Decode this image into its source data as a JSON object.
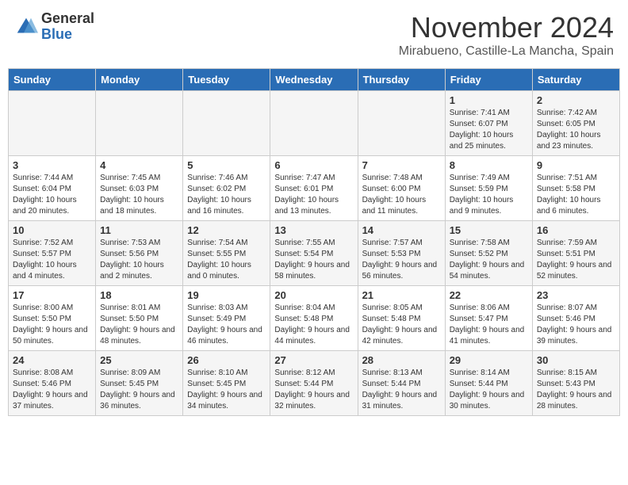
{
  "header": {
    "logo_general": "General",
    "logo_blue": "Blue",
    "month_title": "November 2024",
    "location": "Mirabueno, Castille-La Mancha, Spain"
  },
  "days_of_week": [
    "Sunday",
    "Monday",
    "Tuesday",
    "Wednesday",
    "Thursday",
    "Friday",
    "Saturday"
  ],
  "weeks": [
    [
      {
        "day": "",
        "info": ""
      },
      {
        "day": "",
        "info": ""
      },
      {
        "day": "",
        "info": ""
      },
      {
        "day": "",
        "info": ""
      },
      {
        "day": "",
        "info": ""
      },
      {
        "day": "1",
        "info": "Sunrise: 7:41 AM\nSunset: 6:07 PM\nDaylight: 10 hours and 25 minutes."
      },
      {
        "day": "2",
        "info": "Sunrise: 7:42 AM\nSunset: 6:05 PM\nDaylight: 10 hours and 23 minutes."
      }
    ],
    [
      {
        "day": "3",
        "info": "Sunrise: 7:44 AM\nSunset: 6:04 PM\nDaylight: 10 hours and 20 minutes."
      },
      {
        "day": "4",
        "info": "Sunrise: 7:45 AM\nSunset: 6:03 PM\nDaylight: 10 hours and 18 minutes."
      },
      {
        "day": "5",
        "info": "Sunrise: 7:46 AM\nSunset: 6:02 PM\nDaylight: 10 hours and 16 minutes."
      },
      {
        "day": "6",
        "info": "Sunrise: 7:47 AM\nSunset: 6:01 PM\nDaylight: 10 hours and 13 minutes."
      },
      {
        "day": "7",
        "info": "Sunrise: 7:48 AM\nSunset: 6:00 PM\nDaylight: 10 hours and 11 minutes."
      },
      {
        "day": "8",
        "info": "Sunrise: 7:49 AM\nSunset: 5:59 PM\nDaylight: 10 hours and 9 minutes."
      },
      {
        "day": "9",
        "info": "Sunrise: 7:51 AM\nSunset: 5:58 PM\nDaylight: 10 hours and 6 minutes."
      }
    ],
    [
      {
        "day": "10",
        "info": "Sunrise: 7:52 AM\nSunset: 5:57 PM\nDaylight: 10 hours and 4 minutes."
      },
      {
        "day": "11",
        "info": "Sunrise: 7:53 AM\nSunset: 5:56 PM\nDaylight: 10 hours and 2 minutes."
      },
      {
        "day": "12",
        "info": "Sunrise: 7:54 AM\nSunset: 5:55 PM\nDaylight: 10 hours and 0 minutes."
      },
      {
        "day": "13",
        "info": "Sunrise: 7:55 AM\nSunset: 5:54 PM\nDaylight: 9 hours and 58 minutes."
      },
      {
        "day": "14",
        "info": "Sunrise: 7:57 AM\nSunset: 5:53 PM\nDaylight: 9 hours and 56 minutes."
      },
      {
        "day": "15",
        "info": "Sunrise: 7:58 AM\nSunset: 5:52 PM\nDaylight: 9 hours and 54 minutes."
      },
      {
        "day": "16",
        "info": "Sunrise: 7:59 AM\nSunset: 5:51 PM\nDaylight: 9 hours and 52 minutes."
      }
    ],
    [
      {
        "day": "17",
        "info": "Sunrise: 8:00 AM\nSunset: 5:50 PM\nDaylight: 9 hours and 50 minutes."
      },
      {
        "day": "18",
        "info": "Sunrise: 8:01 AM\nSunset: 5:50 PM\nDaylight: 9 hours and 48 minutes."
      },
      {
        "day": "19",
        "info": "Sunrise: 8:03 AM\nSunset: 5:49 PM\nDaylight: 9 hours and 46 minutes."
      },
      {
        "day": "20",
        "info": "Sunrise: 8:04 AM\nSunset: 5:48 PM\nDaylight: 9 hours and 44 minutes."
      },
      {
        "day": "21",
        "info": "Sunrise: 8:05 AM\nSunset: 5:48 PM\nDaylight: 9 hours and 42 minutes."
      },
      {
        "day": "22",
        "info": "Sunrise: 8:06 AM\nSunset: 5:47 PM\nDaylight: 9 hours and 41 minutes."
      },
      {
        "day": "23",
        "info": "Sunrise: 8:07 AM\nSunset: 5:46 PM\nDaylight: 9 hours and 39 minutes."
      }
    ],
    [
      {
        "day": "24",
        "info": "Sunrise: 8:08 AM\nSunset: 5:46 PM\nDaylight: 9 hours and 37 minutes."
      },
      {
        "day": "25",
        "info": "Sunrise: 8:09 AM\nSunset: 5:45 PM\nDaylight: 9 hours and 36 minutes."
      },
      {
        "day": "26",
        "info": "Sunrise: 8:10 AM\nSunset: 5:45 PM\nDaylight: 9 hours and 34 minutes."
      },
      {
        "day": "27",
        "info": "Sunrise: 8:12 AM\nSunset: 5:44 PM\nDaylight: 9 hours and 32 minutes."
      },
      {
        "day": "28",
        "info": "Sunrise: 8:13 AM\nSunset: 5:44 PM\nDaylight: 9 hours and 31 minutes."
      },
      {
        "day": "29",
        "info": "Sunrise: 8:14 AM\nSunset: 5:44 PM\nDaylight: 9 hours and 30 minutes."
      },
      {
        "day": "30",
        "info": "Sunrise: 8:15 AM\nSunset: 5:43 PM\nDaylight: 9 hours and 28 minutes."
      }
    ]
  ]
}
